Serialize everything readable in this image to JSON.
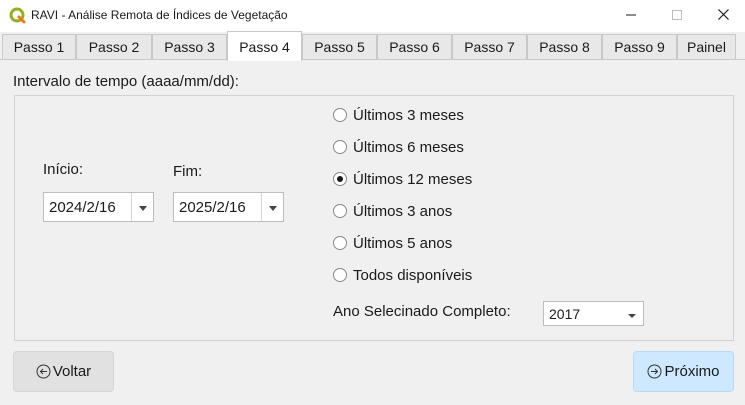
{
  "window": {
    "title": "RAVI - Análise Remota de Índices de Vegetação",
    "app_icon": "qgis-icon",
    "controls": [
      "minimize-icon",
      "maximize-icon",
      "close-icon"
    ]
  },
  "tabs": [
    {
      "label": "Passo 1"
    },
    {
      "label": "Passo 2"
    },
    {
      "label": "Passo 3"
    },
    {
      "label": "Passo 4",
      "active": true
    },
    {
      "label": "Passo 5"
    },
    {
      "label": "Passo 6"
    },
    {
      "label": "Passo 7"
    },
    {
      "label": "Passo 8"
    },
    {
      "label": "Passo 9"
    },
    {
      "label": "Painel"
    }
  ],
  "interval": {
    "label": "Intervalo de tempo (aaaa/mm/dd):",
    "start_label": "Início:",
    "start_value": "2024/2/16",
    "end_label": "Fim:",
    "end_value": "2025/2/16"
  },
  "periods": [
    {
      "label": "Últimos 3 meses",
      "checked": false
    },
    {
      "label": "Últimos 6 meses",
      "checked": false
    },
    {
      "label": "Últimos 12 meses",
      "checked": true
    },
    {
      "label": "Últimos 3 anos",
      "checked": false
    },
    {
      "label": "Últimos 5 anos",
      "checked": false
    },
    {
      "label": "Todos disponíveis",
      "checked": false
    }
  ],
  "year": {
    "label": "Ano Selecinado Completo:",
    "value": "2017"
  },
  "buttons": {
    "back_label": "Voltar",
    "back_icon": "arrow-left-circle-icon",
    "next_label": "Próximo",
    "next_icon": "arrow-right-circle-icon"
  },
  "colors": {
    "next_button_bg": "#cde8ff",
    "back_button_bg": "#e1e1e1",
    "qgis_green": "#93b023"
  }
}
